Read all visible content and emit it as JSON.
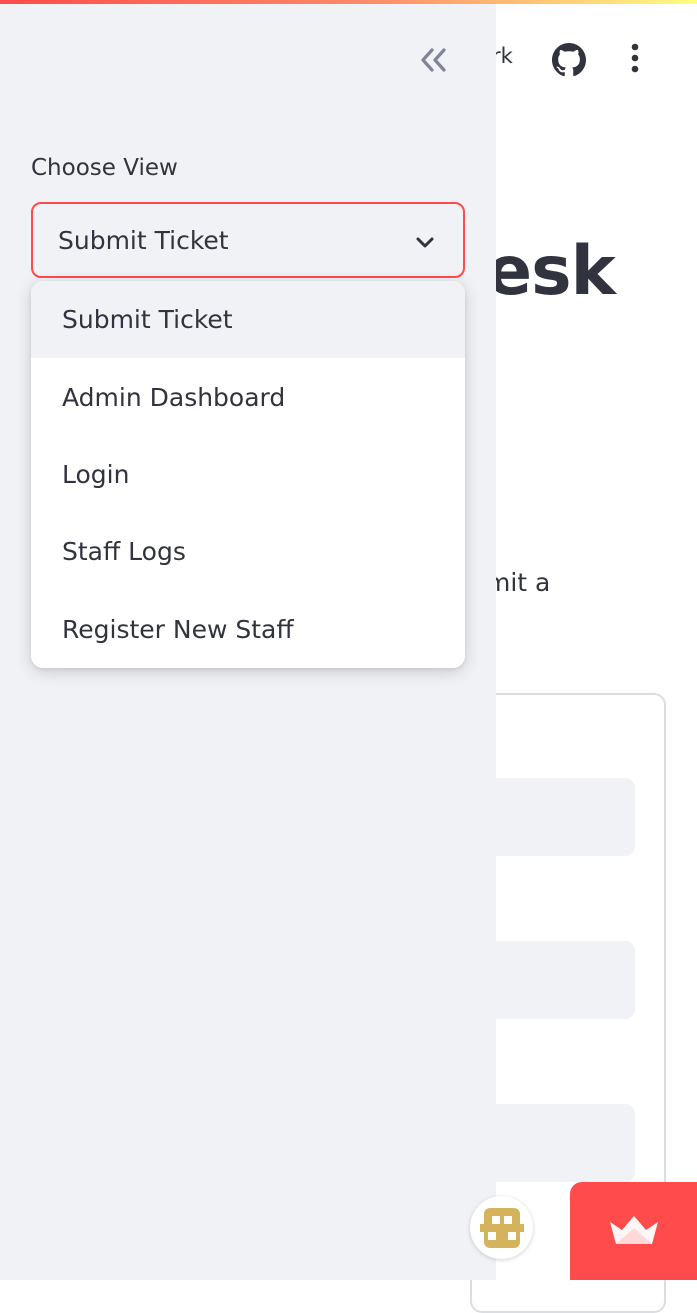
{
  "header": {
    "fork_fragment": "rk",
    "github_icon": "github-icon",
    "menu_icon": "vertical-dots-icon"
  },
  "main": {
    "title_fragment": "esk",
    "paragraph_fragment": "mit a"
  },
  "sidebar": {
    "collapse_icon": "double-chevron-left-icon",
    "select": {
      "label": "Choose View",
      "value": "Submit Ticket",
      "options": [
        "Submit Ticket",
        "Admin Dashboard",
        "Login",
        "Staff Logs",
        "Register New Staff"
      ]
    }
  },
  "colors": {
    "accent": "#ff4b4b",
    "sidebar_bg": "#f0f2f6",
    "text": "#31333f"
  }
}
